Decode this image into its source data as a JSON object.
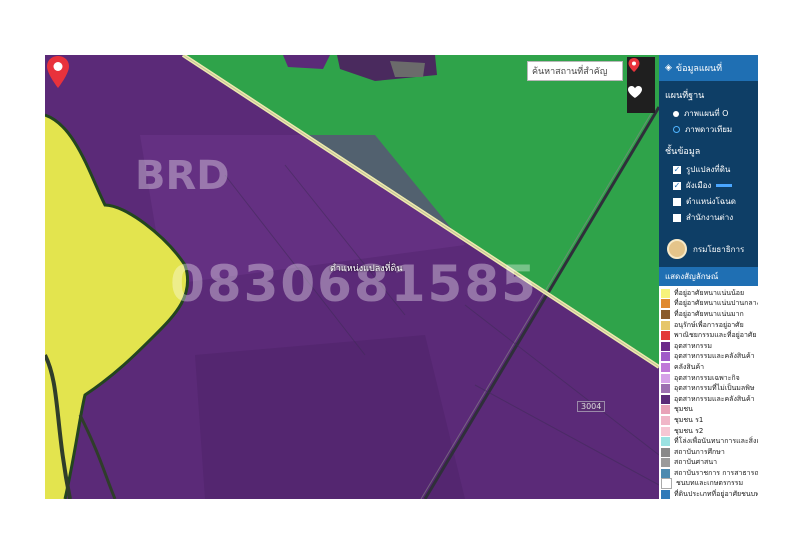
{
  "map": {
    "search": {
      "placeholder": "ค้นหาสถานที่สำคัญ"
    },
    "pin_label": "ตำแหน่งแปลงที่ดิน",
    "road_label": "3004",
    "watermark_text": "0830681585",
    "watermark_text_2": "BRD",
    "colors": {
      "green": "#2fa34a",
      "purple": "#5b2a78",
      "yellow": "#e3e44e",
      "road": "#eeeaae"
    }
  },
  "toolbar": {
    "pin_icon": "map-pin-icon",
    "heart_icon": "heart-icon"
  },
  "panel": {
    "header": "ข้อมูลแผนที่",
    "basemap_title": "แผนที่ฐาน",
    "basemap_items": [
      {
        "label": "ภาพแผนที่ O",
        "selected": true
      },
      {
        "label": "ภาพดาวเทียม",
        "selected": false
      }
    ],
    "data_title": "ชั้นข้อมูล",
    "layer_items": [
      {
        "label": "รูปแปลงที่ดิน",
        "checked": true
      },
      {
        "label": "ผังเมือง",
        "checked": true
      },
      {
        "label": "ตำแหน่งโฉนด",
        "checked": false
      },
      {
        "label": "สำนักงานต่าง",
        "checked": false
      }
    ],
    "agency": "กรมโยธาธิการ",
    "legend_title": "แสดงสัญลักษณ์",
    "legend": [
      {
        "label": "ที่อยู่อาศัยหนาแน่นน้อย",
        "color": "#f7f37a"
      },
      {
        "label": "ที่อยู่อาศัยหนาแน่นปานกลาง",
        "color": "#e08a2f"
      },
      {
        "label": "ที่อยู่อาศัยหนาแน่นมาก",
        "color": "#8a5a2a"
      },
      {
        "label": "อนุรักษ์เพื่อการอยู่อาศัย",
        "color": "#e6c66a"
      },
      {
        "label": "พาณิชยกรรมและที่อยู่อาศัย",
        "color": "#e33a3a"
      },
      {
        "label": "อุตสาหกรรม",
        "color": "#6b2b8a"
      },
      {
        "label": "อุตสาหกรรมและคลังสินค้า",
        "color": "#a05bc8"
      },
      {
        "label": "คลังสินค้า",
        "color": "#c078d8"
      },
      {
        "label": "อุตสาหกรรมเฉพาะกิจ",
        "color": "#d6a2e8"
      },
      {
        "label": "อุตสาหกรรมที่ไม่เป็นมลพิษ",
        "color": "#9c6fb0"
      },
      {
        "label": "อุตสาหกรรมและคลังสินค้า",
        "color": "#5b2a78"
      },
      {
        "label": "ชุมชน",
        "color": "#e8a2b8"
      },
      {
        "label": "ชุมชน ร1",
        "color": "#f0b6c8"
      },
      {
        "label": "ชุมชน ร2",
        "color": "#f6c6d4"
      },
      {
        "label": "ที่โล่งเพื่อนันทนาการและสิ่งแวดล้อม",
        "color": "#9be2e2"
      },
      {
        "label": "สถาบันการศึกษา",
        "color": "#8a8a8a"
      },
      {
        "label": "สถาบันศาสนา",
        "color": "#9b9b9b"
      },
      {
        "label": "สถาบันราชการ การสาธารณูปโภค",
        "color": "#4d8ab0"
      },
      {
        "label": "ชนบทและเกษตรกรรม",
        "color": "#ffffff"
      },
      {
        "label": "ที่ดินประเภทที่อยู่อาศัยชนบท",
        "color": "#2f7ab8"
      }
    ]
  }
}
